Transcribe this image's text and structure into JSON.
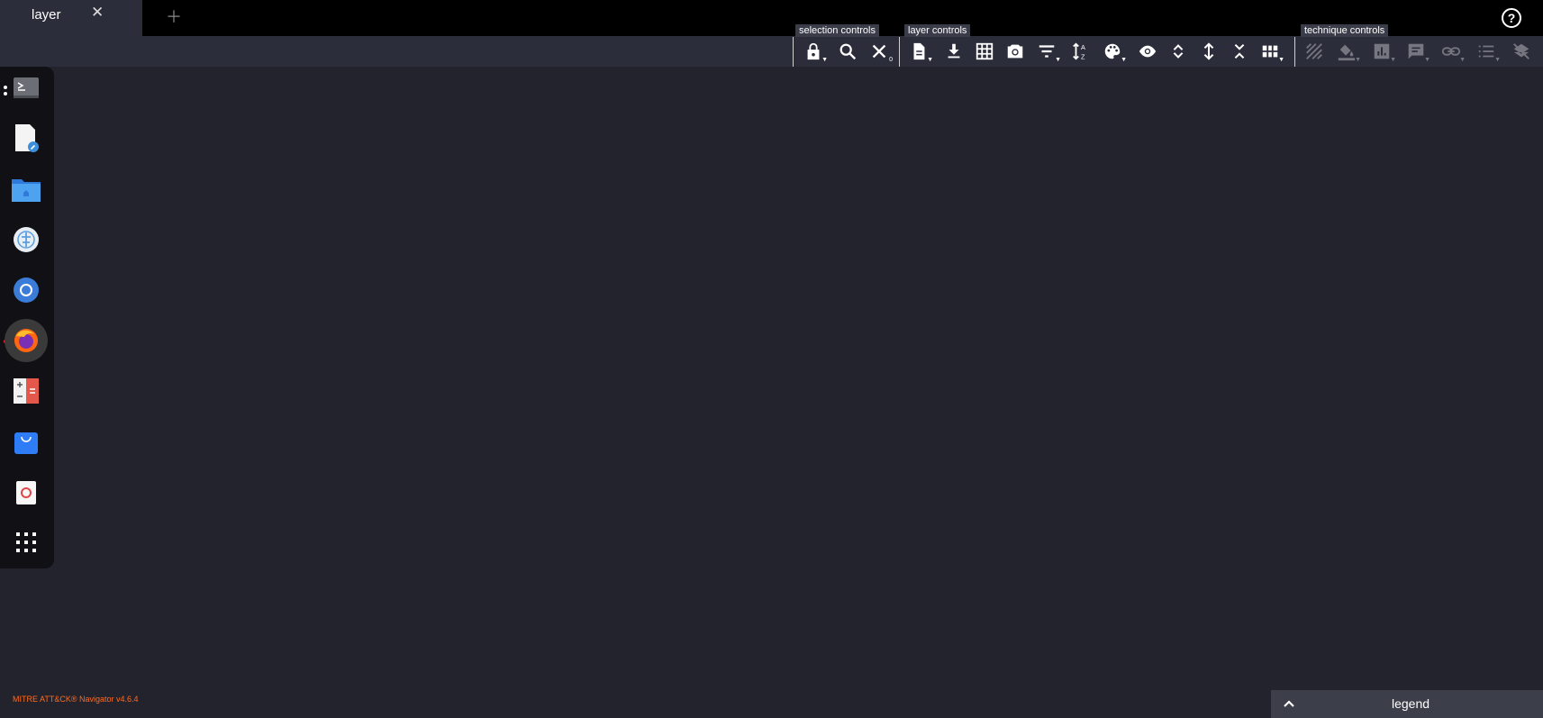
{
  "tab": {
    "label": "layer",
    "close_icon": "close-icon",
    "new_tab_icon": "plus-icon"
  },
  "help": {
    "label": "?"
  },
  "groups": {
    "selection": "selection controls",
    "layer": "layer controls",
    "technique": "technique controls"
  },
  "selection_tools": [
    {
      "name": "lock-icon",
      "dropdown": true
    },
    {
      "name": "search-icon"
    },
    {
      "name": "deselect-icon",
      "badge": "0"
    }
  ],
  "layer_tools": [
    {
      "name": "layer-info-icon",
      "dropdown": true
    },
    {
      "name": "download-icon"
    },
    {
      "name": "export-excel-icon"
    },
    {
      "name": "render-svg-icon"
    },
    {
      "name": "filter-icon",
      "dropdown": true
    },
    {
      "name": "sort-icon"
    },
    {
      "name": "color-setup-icon",
      "dropdown": true
    },
    {
      "name": "show-hide-icon"
    },
    {
      "name": "expand-subtechniques-icon"
    },
    {
      "name": "expand-all-icon"
    },
    {
      "name": "collapse-icon"
    },
    {
      "name": "layout-icon",
      "dropdown": true
    }
  ],
  "technique_tools": [
    {
      "name": "toggle-state-icon"
    },
    {
      "name": "background-color-icon",
      "dropdown": true
    },
    {
      "name": "scoring-icon",
      "dropdown": true
    },
    {
      "name": "comment-icon",
      "dropdown": true
    },
    {
      "name": "link-icon",
      "dropdown": true
    },
    {
      "name": "metadata-icon",
      "dropdown": true
    },
    {
      "name": "clear-annotations-icon"
    }
  ],
  "dock": [
    {
      "name": "terminal-icon"
    },
    {
      "name": "text-editor-icon"
    },
    {
      "name": "files-icon"
    },
    {
      "name": "software-icon"
    },
    {
      "name": "chromium-icon"
    },
    {
      "name": "firefox-icon",
      "active": true
    },
    {
      "name": "calculator-icon"
    },
    {
      "name": "store-icon"
    },
    {
      "name": "trash-icon"
    },
    {
      "name": "apps-grid-icon"
    }
  ],
  "footer": {
    "brand": "MITRE ATT&CK® Navigator v4.6.4"
  },
  "legend": {
    "label": "legend",
    "icon": "chevron-up-icon"
  },
  "colors": {
    "brand": "#ff6a1f",
    "background": "#23232d",
    "toolbar": "#2b2d3b"
  }
}
